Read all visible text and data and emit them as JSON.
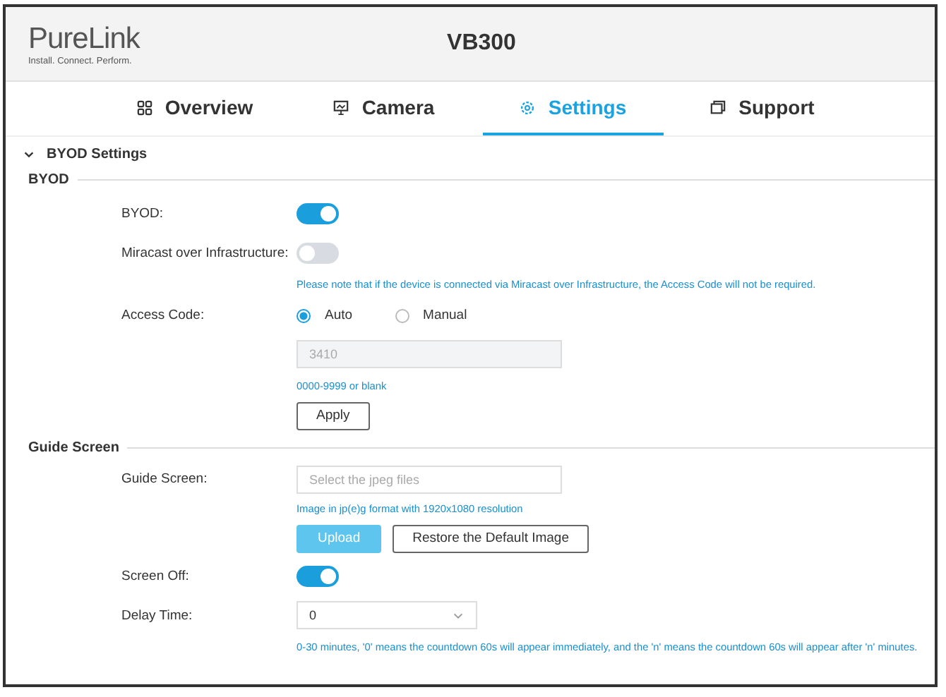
{
  "header": {
    "logo": "PureLink",
    "tagline": "Install. Connect. Perform.",
    "title": "VB300"
  },
  "tabs": [
    {
      "label": "Overview",
      "selected": false
    },
    {
      "label": "Camera",
      "selected": false
    },
    {
      "label": "Settings",
      "selected": true
    },
    {
      "label": "Support",
      "selected": false
    }
  ],
  "panel": {
    "title": "BYOD Settings",
    "expanded": true
  },
  "sections": [
    {
      "title": "BYOD",
      "rows": [
        {
          "kind": "toggle",
          "label": "BYOD:",
          "on": true
        },
        {
          "kind": "toggle",
          "label": "Miracast over Infrastructure:",
          "on": false
        },
        {
          "kind": "note",
          "text": "Please note that if the device is connected via Miracast over Infrastructure, the Access Code will not be required."
        },
        {
          "kind": "radio",
          "label": "Access Code:",
          "options": [
            {
              "label": "Auto",
              "selected": true
            },
            {
              "label": "Manual",
              "selected": false
            }
          ]
        },
        {
          "kind": "input",
          "value": "3410",
          "disabled": true
        },
        {
          "kind": "note",
          "text": "0000-9999 or blank"
        },
        {
          "kind": "buttons",
          "buttons": [
            {
              "label": "Apply",
              "primary": false
            }
          ]
        }
      ]
    },
    {
      "title": "Guide Screen",
      "rows": [
        {
          "kind": "file",
          "label": "Guide Screen:",
          "placeholder": "Select the jpeg files"
        },
        {
          "kind": "note",
          "text": "Image in jp(e)g format with 1920x1080 resolution"
        },
        {
          "kind": "buttons",
          "buttons": [
            {
              "label": "Upload",
              "primary": true
            },
            {
              "label": "Restore the Default Image",
              "primary": false
            }
          ]
        },
        {
          "kind": "toggle",
          "label": "Screen Off:",
          "on": true
        },
        {
          "kind": "select",
          "label": "Delay Time:",
          "value": "0"
        },
        {
          "kind": "note",
          "text": "0-30 minutes, '0' means the countdown 60s will appear immediately, and the 'n' means the countdown 60s will appear after 'n' minutes."
        }
      ]
    }
  ]
}
